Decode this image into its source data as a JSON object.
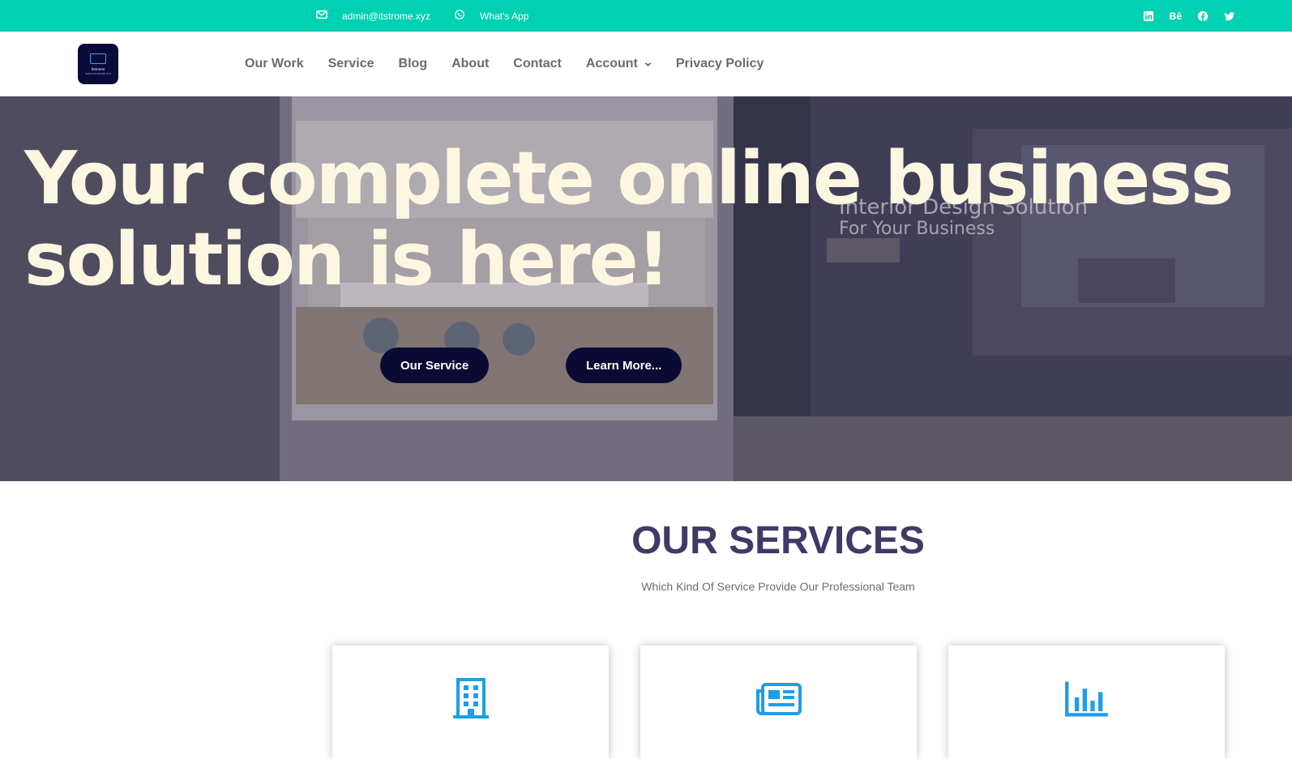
{
  "topbar": {
    "email": "admin@itstrome.xyz",
    "whatsapp": "What's App",
    "social_icons": [
      "linkedin-icon",
      "behance-icon",
      "facebook-icon",
      "twitter-icon"
    ],
    "behance_text": "Bē",
    "bg_color": "#00d1b2"
  },
  "logo": {
    "line1": "Itstrome",
    "line2": "WWW.ITSTROME.XYZ"
  },
  "nav": {
    "items": [
      "Our Work",
      "Service",
      "Blog",
      "About",
      "Contact",
      "Account",
      "Privacy Policy"
    ]
  },
  "hero": {
    "title": "Your complete online business solution is here!",
    "bg_text_1": "Interior Design Solution",
    "bg_text_2": "For Your Business",
    "button_primary": "Our Service",
    "button_secondary": "Learn More..."
  },
  "services": {
    "title": "OUR SERVICES",
    "subtitle": "Which Kind Of Service Provide Our Professional Team",
    "cards": [
      {
        "icon": "building-icon"
      },
      {
        "icon": "newspaper-icon"
      },
      {
        "icon": "chart-bar-icon"
      }
    ],
    "accent_color": "#1e9ee8"
  }
}
